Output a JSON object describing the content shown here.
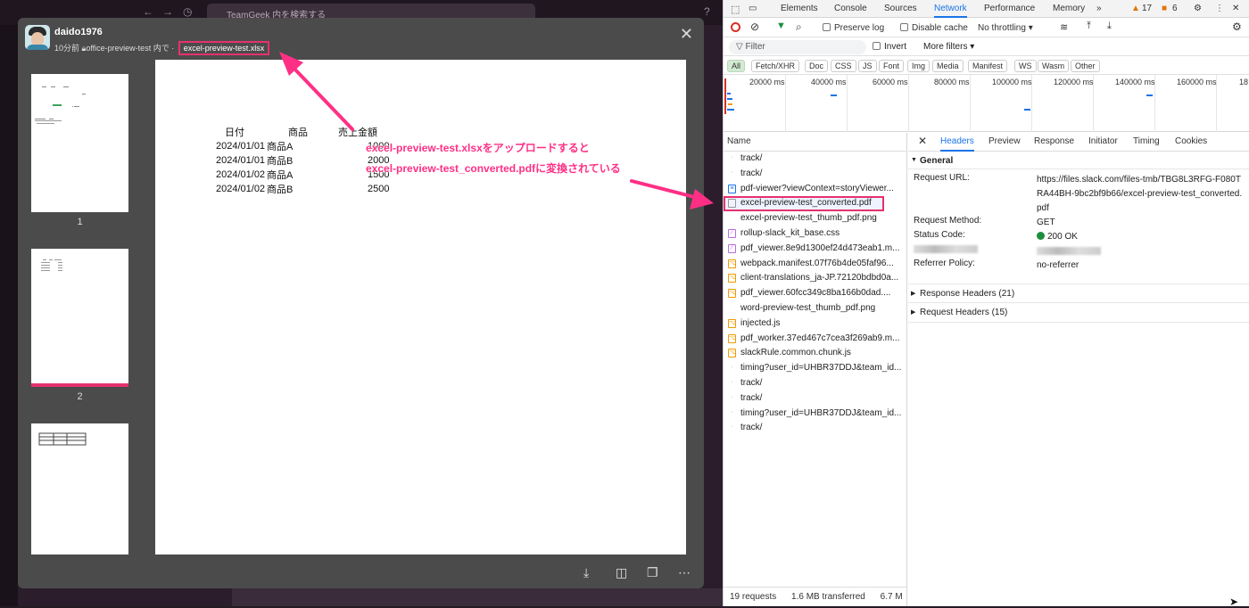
{
  "slack": {
    "search_placeholder": "TeamGeek 内を検索する",
    "back_icon": "arrow-left-icon",
    "history_icon": "clock-icon"
  },
  "modal": {
    "username": "daido1976",
    "time": "10分前",
    "channel": "office-preview-test",
    "channel_suffix": "内で",
    "filename": "excel-preview-test.xlsx",
    "thumb_labels": [
      "1",
      "2"
    ],
    "page_headers": [
      "日付",
      "商品",
      "売上金額"
    ],
    "page_rows": [
      [
        "2024/01/01",
        "商品A",
        "1000"
      ],
      [
        "2024/01/01",
        "商品B",
        "2000"
      ],
      [
        "2024/01/02",
        "商品A",
        "1500"
      ],
      [
        "2024/01/02",
        "商品B",
        "2500"
      ]
    ],
    "annotation_line1": "excel-preview-test.xlsxをアップロードすると",
    "annotation_line2": "excel-preview-test_converted.pdfに変換されている",
    "accent_color": "#e5316f"
  },
  "devtools": {
    "tabs": [
      "Elements",
      "Console",
      "Sources",
      "Network",
      "Performance",
      "Memory",
      "»"
    ],
    "warning_count": "17",
    "issue_count": "6",
    "toolbar": {
      "preserve_log": "Preserve log",
      "disable_cache": "Disable cache",
      "throttling": "No throttling"
    },
    "filter": {
      "placeholder": "Filter",
      "invert": "Invert",
      "more": "More filters ▾"
    },
    "type_chips": [
      "All",
      "Fetch/XHR",
      "Doc",
      "CSS",
      "JS",
      "Font",
      "Img",
      "Media",
      "Manifest",
      "WS",
      "Wasm",
      "Other"
    ],
    "overview_labels": [
      "20000 ms",
      "40000 ms",
      "60000 ms",
      "80000 ms",
      "100000 ms",
      "120000 ms",
      "140000 ms",
      "160000 ms",
      "18"
    ],
    "name_header": "Name",
    "requests": [
      {
        "name": "track/",
        "type": "other"
      },
      {
        "name": "track/",
        "type": "other"
      },
      {
        "name": "pdf-viewer?viewContext=storyViewer...",
        "type": "doc"
      },
      {
        "name": "excel-preview-test_converted.pdf",
        "type": "file"
      },
      {
        "name": "excel-preview-test_thumb_pdf.png",
        "type": "img"
      },
      {
        "name": "rollup-slack_kit_base.css",
        "type": "css"
      },
      {
        "name": "pdf_viewer.8e9d1300ef24d473eab1.m...",
        "type": "css"
      },
      {
        "name": "webpack.manifest.07f76b4de05faf96...",
        "type": "js"
      },
      {
        "name": "client-translations_ja-JP.72120bdbd0a...",
        "type": "js"
      },
      {
        "name": "pdf_viewer.60fcc349c8ba166b0dad....",
        "type": "js"
      },
      {
        "name": "word-preview-test_thumb_pdf.png",
        "type": "img"
      },
      {
        "name": "injected.js",
        "type": "js"
      },
      {
        "name": "pdf_worker.37ed467c7cea3f269ab9.m...",
        "type": "js"
      },
      {
        "name": "slackRule.common.chunk.js",
        "type": "js"
      },
      {
        "name": "timing?user_id=UHBR37DDJ&team_id...",
        "type": "other"
      },
      {
        "name": "track/",
        "type": "other"
      },
      {
        "name": "track/",
        "type": "other"
      },
      {
        "name": "timing?user_id=UHBR37DDJ&team_id...",
        "type": "other"
      },
      {
        "name": "track/",
        "type": "other"
      }
    ],
    "footer": {
      "requests": "19 requests",
      "transferred": "1.6 MB transferred",
      "resources": "6.7 M"
    },
    "detail_tabs": [
      "Headers",
      "Preview",
      "Response",
      "Initiator",
      "Timing",
      "Cookies"
    ],
    "general": {
      "section": "General",
      "request_url_label": "Request URL:",
      "request_url": "https://files.slack.com/files-tmb/TBG8L3RFG-F080TRA44BH-9bc2bf9b66/excel-preview-test_converted.pdf",
      "method_label": "Request Method:",
      "method": "GET",
      "status_label": "Status Code:",
      "status": "200 OK",
      "referrer_label": "Referrer Policy:",
      "referrer": "no-referrer"
    },
    "response_headers": "Response Headers (21)",
    "request_headers": "Request Headers (15)"
  }
}
